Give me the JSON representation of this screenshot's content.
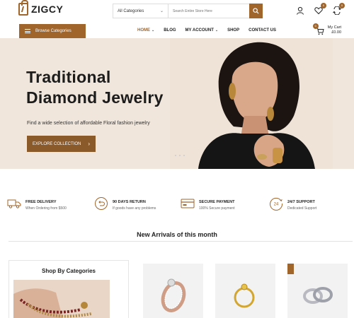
{
  "header": {
    "logo_text": "ZIGCY",
    "search": {
      "category": "All Categories",
      "placeholder": "Search Entire Store Here"
    },
    "wishlist_count": "0",
    "compare_count": "0"
  },
  "nav": {
    "browse_label": "Browse Categories",
    "menu": [
      {
        "label": "HOME",
        "active": true
      },
      {
        "label": "BLOG"
      },
      {
        "label": "MY ACCOUNT"
      },
      {
        "label": "SHOP"
      },
      {
        "label": "CONTACT US"
      }
    ],
    "cart": {
      "label": "My Cart",
      "amount": "£0.00",
      "count": "0"
    }
  },
  "hero": {
    "title_line1": "Traditional",
    "title_line2": "Diamond Jewelry",
    "subtitle": "Find a wide selection of affordable Floral fashion jewelry",
    "cta_label": "EXPLORE COLLECTION"
  },
  "features": [
    {
      "title": "FREE DELIVERY",
      "desc": "When Ordering from $500",
      "icon": "truck-icon"
    },
    {
      "title": "90 DAYS RETURN",
      "desc": "If goods have any problems",
      "icon": "return-icon"
    },
    {
      "title": "SECURE PAYMENT",
      "desc": "100% Secure payment",
      "icon": "card-icon"
    },
    {
      "title": "24/7 SUPPORT",
      "desc": "Dedicated Support",
      "icon": "support-icon"
    }
  ],
  "new_arrivals_title": "New Arrivals of this month",
  "shop_by_categories_title": "Shop By Categories",
  "colors": {
    "accent": "#a0652b",
    "hero_bg": "#f0e6dc"
  }
}
